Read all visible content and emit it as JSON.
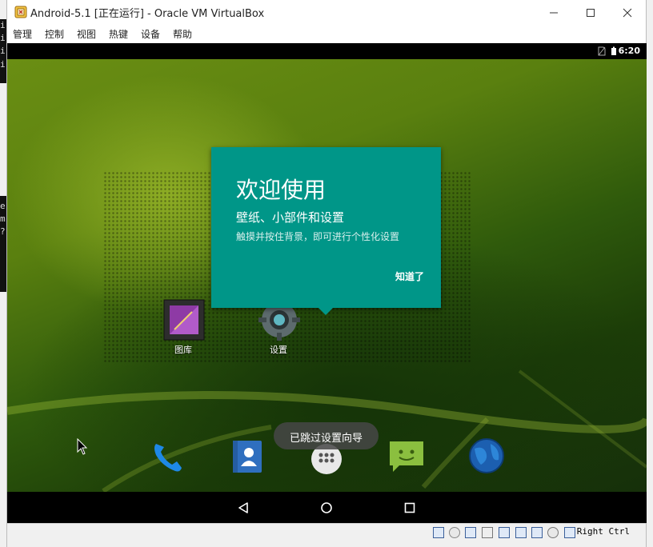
{
  "window": {
    "title": "Android-5.1 [正在运行] - Oracle VM VirtualBox",
    "minimize_label": "—",
    "maximize_label": "☐",
    "close_label": "✕"
  },
  "menu": {
    "items": [
      "管理",
      "控制",
      "视图",
      "热键",
      "设备",
      "帮助"
    ]
  },
  "android": {
    "statusbar": {
      "time": "6:20"
    },
    "welcome": {
      "title": "欢迎使用",
      "subtitle": "壁纸、小部件和设置",
      "description": "触摸并按住背景，即可进行个性化设置",
      "button": "知道了"
    },
    "home_icons": [
      {
        "label": "图库",
        "icon": "gallery-icon"
      },
      {
        "label": "设置",
        "icon": "settings-gear-icon"
      }
    ],
    "toast": "已跳过设置向导",
    "dock": [
      "phone-icon",
      "contacts-icon",
      "app-drawer-icon",
      "messaging-icon",
      "browser-globe-icon"
    ],
    "nav": [
      "back-icon",
      "home-icon",
      "recents-icon"
    ],
    "accent_color": "#009688"
  },
  "background_window": {
    "left_chars": [
      "i",
      "i",
      "i",
      "i",
      "e",
      "m",
      "?"
    ]
  },
  "status_bar": {
    "host_key": "Right Ctrl"
  }
}
